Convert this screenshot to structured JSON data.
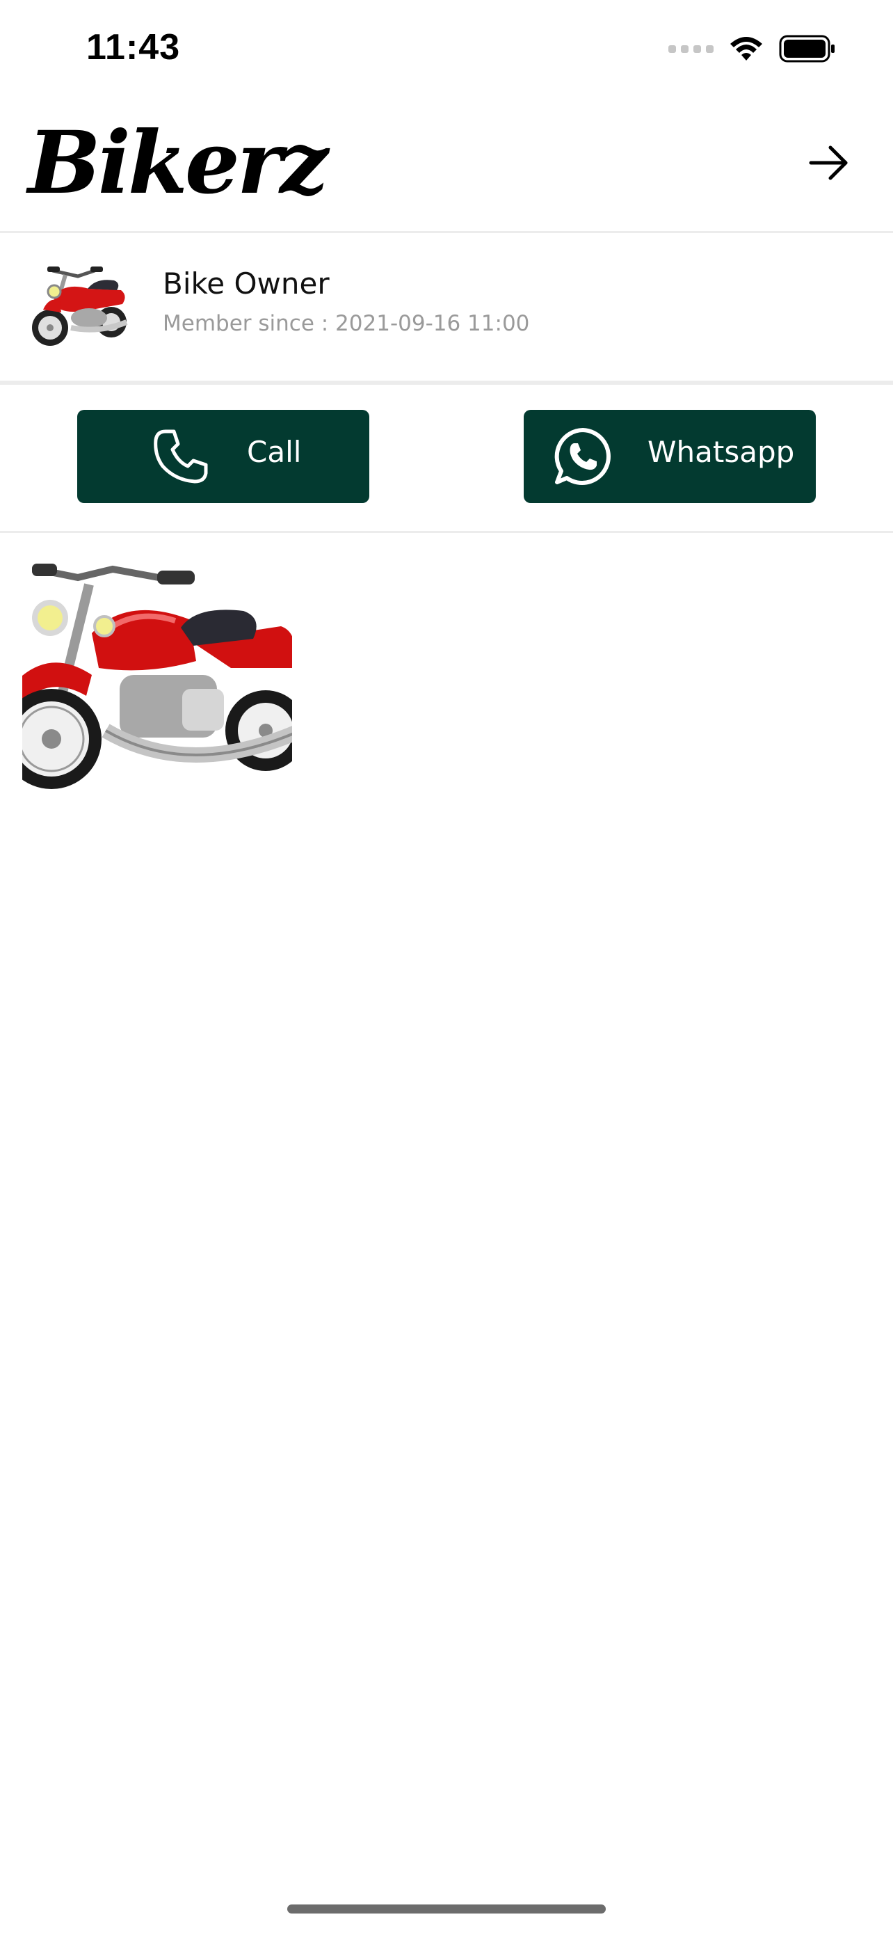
{
  "status_bar": {
    "time": "11:43",
    "icons": [
      "cellular-signal-icon",
      "wifi-icon",
      "battery-icon"
    ]
  },
  "header": {
    "logo_text": "Bikerz",
    "action_icon": "arrow-right-icon"
  },
  "profile": {
    "name": "Bike Owner",
    "member_since": "Member since : 2021-09-16 11:00",
    "avatar": "motorcycle-avatar"
  },
  "contact": {
    "call_label": "Call",
    "call_icon": "phone-icon",
    "whatsapp_label": "Whatsapp",
    "whatsapp_icon": "whatsapp-icon",
    "button_color": "#033a30"
  },
  "gallery": {
    "items": [
      "motorcycle-photo"
    ]
  }
}
